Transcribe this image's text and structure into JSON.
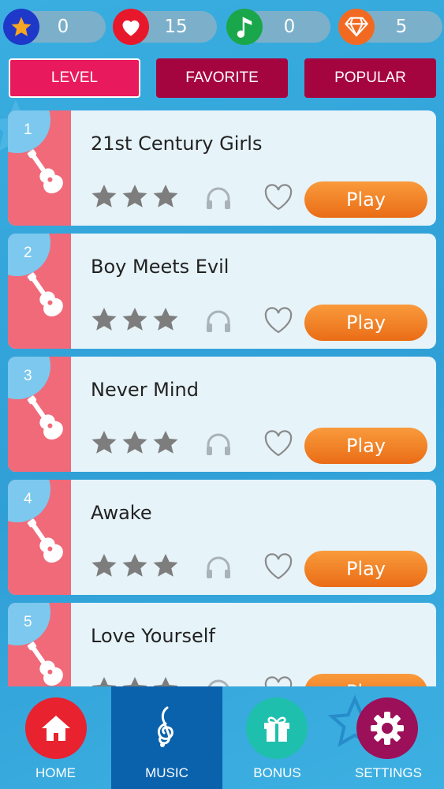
{
  "stats": [
    {
      "name": "stars",
      "value": "0",
      "icon": "star-icon",
      "color": "#1e38c9"
    },
    {
      "name": "hearts",
      "value": "15",
      "icon": "heart-icon",
      "color": "#e8182c"
    },
    {
      "name": "notes",
      "value": "0",
      "icon": "music-note-icon",
      "color": "#1aa64a"
    },
    {
      "name": "diamonds",
      "value": "5",
      "icon": "diamond-icon",
      "color": "#f26a22"
    }
  ],
  "tabs": [
    {
      "label": "LEVEL",
      "active": true
    },
    {
      "label": "FAVORITE",
      "active": false
    },
    {
      "label": "POPULAR",
      "active": false
    }
  ],
  "songs": [
    {
      "number": "1",
      "title": "21st Century Girls",
      "stars": 3,
      "action": "Play"
    },
    {
      "number": "2",
      "title": "Boy Meets Evil",
      "stars": 3,
      "action": "Play"
    },
    {
      "number": "3",
      "title": "Never Mind",
      "stars": 3,
      "action": "Play"
    },
    {
      "number": "4",
      "title": "Awake",
      "stars": 3,
      "action": "Play"
    },
    {
      "number": "5",
      "title": "Love Yourself",
      "stars": 3,
      "action": "Play"
    }
  ],
  "nav": [
    {
      "label": "HOME",
      "icon": "home-icon",
      "color": "#e8222e",
      "active": false
    },
    {
      "label": "MUSIC",
      "icon": "treble-clef-icon",
      "color": "#0a62ad",
      "active": true
    },
    {
      "label": "BONUS",
      "icon": "gift-icon",
      "color": "#1fbfae",
      "active": false
    },
    {
      "label": "SETTINGS",
      "icon": "gear-icon",
      "color": "#9c0f59",
      "active": false
    }
  ],
  "colors": {
    "background": "#35a8dd",
    "tab_active": "#e8195d",
    "tab_inactive": "#a5053f",
    "card": "#e6f3f9",
    "card_side": "#f06a7a",
    "play_button": "#f08a2c"
  }
}
